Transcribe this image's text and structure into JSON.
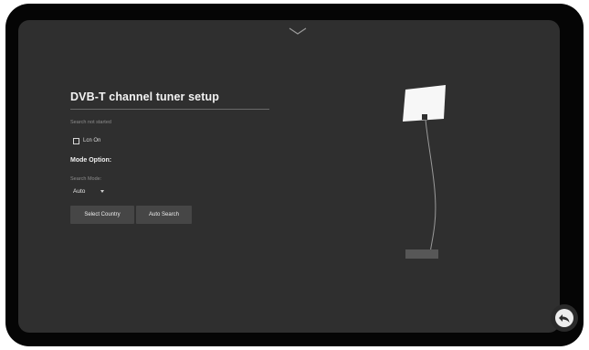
{
  "app": {
    "title": "DVB-T channel tuner setup",
    "status": "Search not started",
    "lcn": {
      "label": "Lcn On",
      "checked": false
    },
    "mode_option": {
      "heading": "Mode Option:",
      "search_mode_label": "Search Mode:",
      "search_mode_value": "Auto"
    },
    "buttons": {
      "select_country": "Select Country",
      "auto_search": "Auto Search"
    }
  },
  "icons": {
    "top_handle": "chevron-down-icon",
    "side_handle": "chevron-left-icon",
    "back": "back-arrow-icon",
    "illustration": "antenna-icon"
  },
  "colors": {
    "frame": "#050505",
    "screen": "#2f2f2f",
    "button": "#464646",
    "text": "#f2f2f2",
    "muted_text": "#8c8c8c"
  }
}
